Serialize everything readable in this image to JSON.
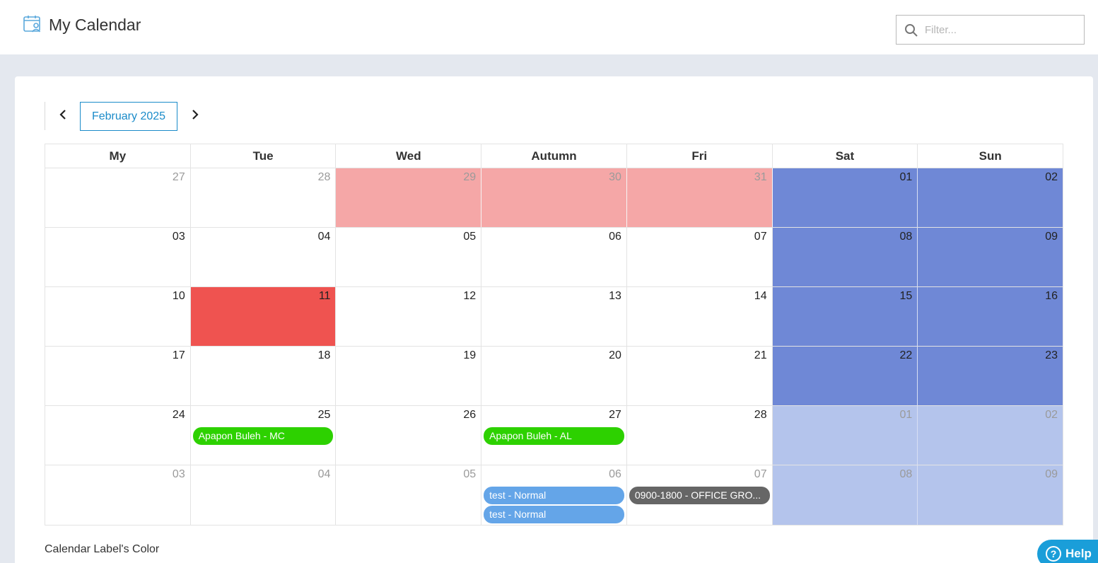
{
  "header": {
    "title": "My Calendar",
    "filter_placeholder": "Filter..."
  },
  "nav": {
    "month_label": "February 2025"
  },
  "calendar": {
    "weekdays": [
      "My",
      "Tue",
      "Wed",
      "Autumn",
      "Fri",
      "Sat",
      "Sun"
    ],
    "weeks": [
      [
        "27",
        "28",
        "29",
        "30",
        "31",
        "01",
        "02"
      ],
      [
        "03",
        "04",
        "05",
        "06",
        "07",
        "08",
        "09"
      ],
      [
        "10",
        "11",
        "12",
        "13",
        "14",
        "15",
        "16"
      ],
      [
        "17",
        "18",
        "19",
        "20",
        "21",
        "22",
        "23"
      ],
      [
        "24",
        "25",
        "26",
        "27",
        "28",
        "01",
        "02"
      ],
      [
        "03",
        "04",
        "05",
        "06",
        "07",
        "08",
        "09"
      ]
    ],
    "events": [
      {
        "week": 4,
        "day": 1,
        "slot": 0,
        "label": "Apapon Buleh - MC",
        "color": "#2dd100"
      },
      {
        "week": 4,
        "day": 3,
        "slot": 0,
        "label": "Apapon Buleh - AL",
        "color": "#2dd100"
      },
      {
        "week": 5,
        "day": 3,
        "slot": 0,
        "label": "test - Normal",
        "color": "#64a5e8"
      },
      {
        "week": 5,
        "day": 3,
        "slot": 1,
        "label": "test - Normal",
        "color": "#64a5e8"
      },
      {
        "week": 5,
        "day": 4,
        "slot": 0,
        "label": "0900-1800 - OFFICE GRO...",
        "color": "#666666"
      }
    ]
  },
  "colors": {
    "holiday_pink": "#f5a7a7",
    "today_red": "#ef5350",
    "weekend_blue": "#6f88d6",
    "weekend_light_blue": "#b4c4ec",
    "accent": "#1a8bc9"
  },
  "legend": {
    "title": "Calendar Label's Color"
  },
  "help": {
    "label": "Help"
  }
}
